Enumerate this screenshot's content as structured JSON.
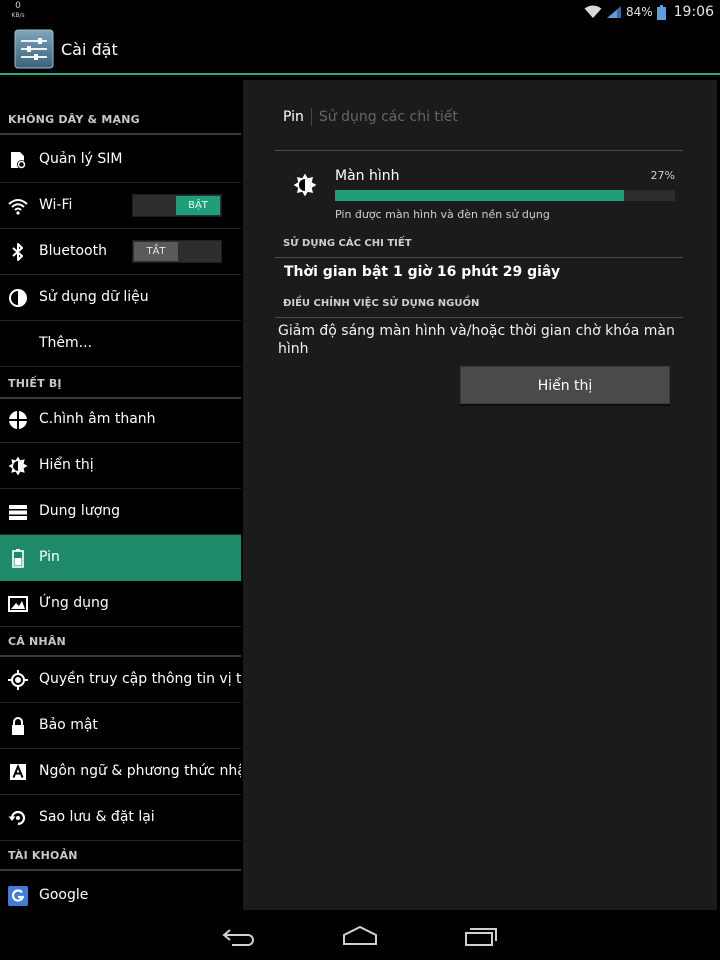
{
  "status_bar": {
    "speed_value": "0",
    "speed_unit": "KB/s",
    "battery_percent": "84%",
    "time": "19:06"
  },
  "action_bar": {
    "title": "Cài đặt",
    "icon": "settings-sliders-icon"
  },
  "sidebar": {
    "sections": [
      {
        "header": "KHÔNG DÂY & MẠNG"
      },
      {
        "header": "THIẾT BỊ"
      },
      {
        "header": "CÁ NHÂN"
      },
      {
        "header": "TÀI KHOẢN"
      }
    ],
    "items": [
      {
        "label": "Quản lý SIM",
        "icon": "sim-card-icon"
      },
      {
        "label": "Wi-Fi",
        "icon": "wifi-icon",
        "toggle": "BẬT"
      },
      {
        "label": "Bluetooth",
        "icon": "bluetooth-icon",
        "toggle": "TẮT"
      },
      {
        "label": "Sử dụng dữ liệu",
        "icon": "data-usage-icon"
      },
      {
        "label": "Thêm..."
      },
      {
        "label": "C.hình âm thanh",
        "icon": "sound-icon"
      },
      {
        "label": "Hiển thị",
        "icon": "brightness-icon"
      },
      {
        "label": "Dung lượng",
        "icon": "storage-icon"
      },
      {
        "label": "Pin",
        "icon": "battery-icon",
        "selected": true
      },
      {
        "label": "Ứng dụng",
        "icon": "apps-icon"
      },
      {
        "label": "Quyền truy cập thông tin vị trí",
        "icon": "location-icon"
      },
      {
        "label": "Bảo mật",
        "icon": "lock-icon"
      },
      {
        "label": "Ngôn ngữ & phương thức nhập",
        "icon": "language-icon"
      },
      {
        "label": "Sao lưu & đặt lại",
        "icon": "backup-icon"
      },
      {
        "label": "Google",
        "icon": "google-icon"
      }
    ]
  },
  "detail": {
    "breadcrumb": [
      "Pin",
      "Sử dụng các chi tiết"
    ],
    "usage": {
      "name": "Màn hình",
      "percent_label": "27%",
      "percent_fill": 0.85,
      "description": "Pin được màn hình và đèn nền sử dụng",
      "icon": "brightness-icon"
    },
    "details_header": "SỬ DỤNG CÁC CHI TIẾT",
    "details_text": "Thời gian bật 1 giờ 16 phút 29 giây",
    "adjust_header": "ĐIỀU CHỈNH VIỆC SỬ DỤNG NGUỒN",
    "adjust_text": "Giảm độ sáng màn hình và/hoặc thời gian chờ khóa màn hình",
    "display_button": "Hiển thị"
  },
  "nav_bar": {
    "buttons": [
      "back-icon",
      "home-icon",
      "recents-icon"
    ]
  },
  "colors": {
    "accent": "#1f9e7a",
    "selected_row": "#1f8a6a",
    "action_bar_line": "#2aa882",
    "detail_background": "#1b1b1b"
  }
}
